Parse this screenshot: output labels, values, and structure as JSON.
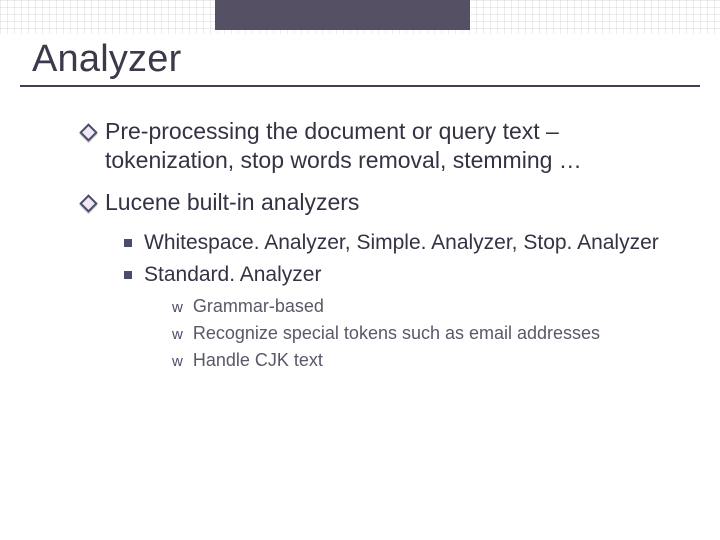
{
  "title": "Analyzer",
  "bullets": [
    {
      "text": "Pre-processing the document or query text – tokenization, stop words removal, stemming …"
    },
    {
      "text": "Lucene built-in analyzers",
      "children": [
        {
          "text": "Whitespace. Analyzer, Simple. Analyzer, Stop. Analyzer"
        },
        {
          "text": "Standard. Analyzer",
          "children": [
            {
              "text": "Grammar-based"
            },
            {
              "text": "Recognize special tokens such as email addresses"
            },
            {
              "text": "Handle CJK text"
            }
          ]
        }
      ]
    }
  ]
}
